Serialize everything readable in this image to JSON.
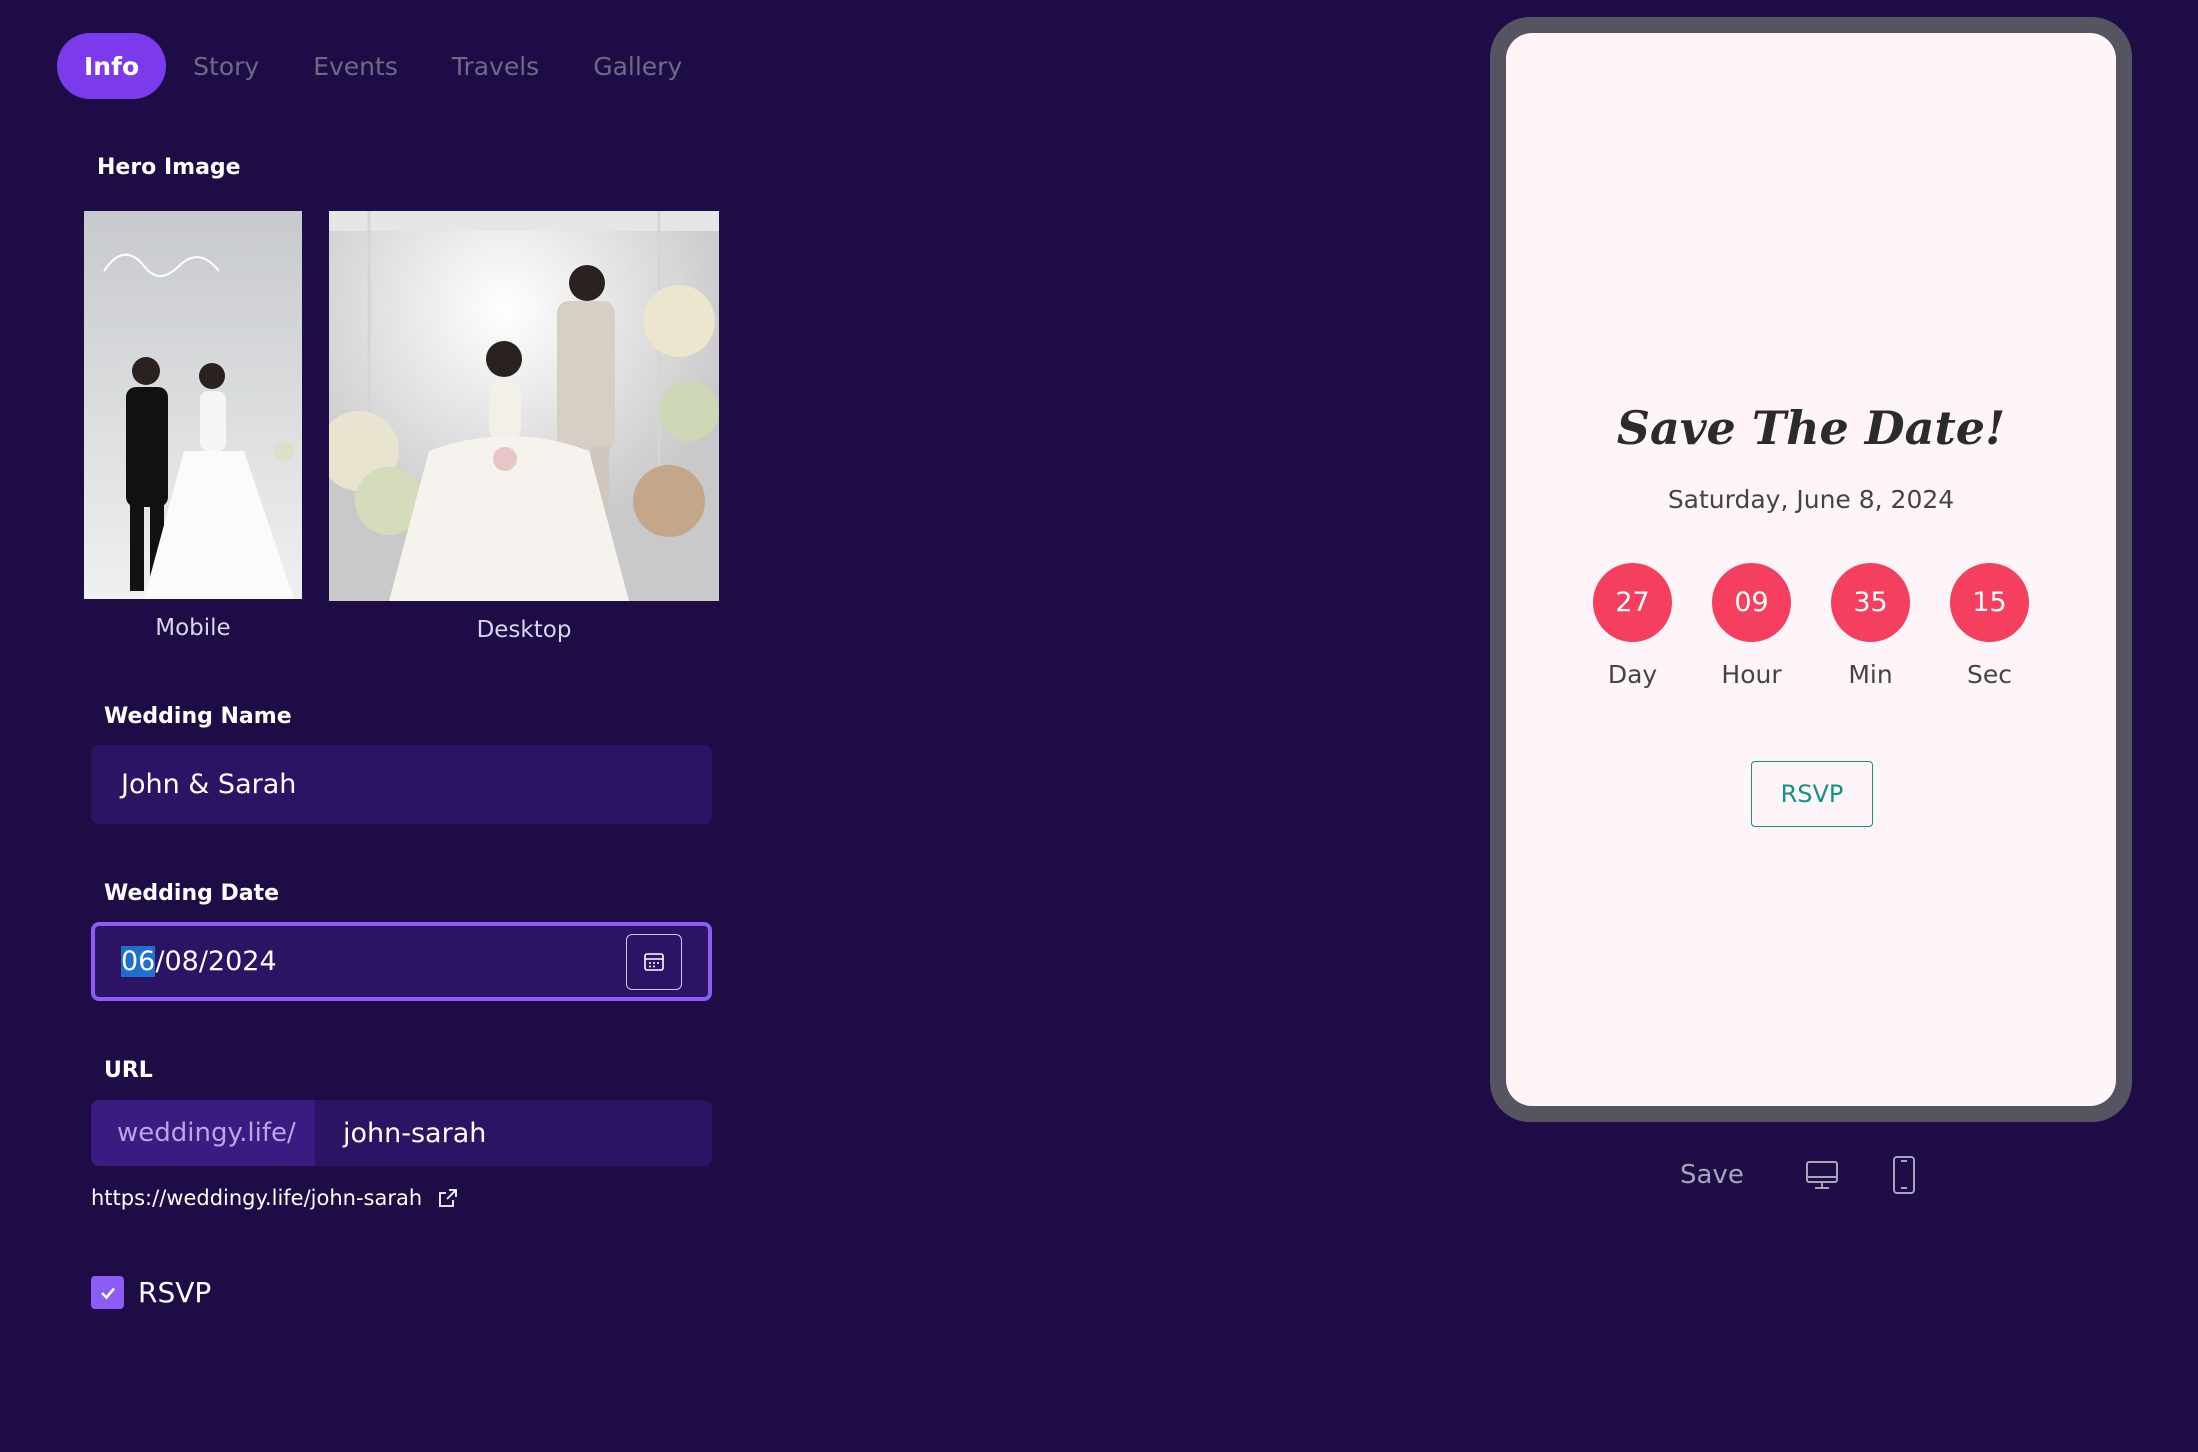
{
  "tabs": [
    {
      "label": "Info",
      "active": true
    },
    {
      "label": "Story",
      "active": false
    },
    {
      "label": "Events",
      "active": false
    },
    {
      "label": "Travels",
      "active": false
    },
    {
      "label": "Gallery",
      "active": false
    }
  ],
  "hero": {
    "label": "Hero Image",
    "mobile_caption": "Mobile",
    "desktop_caption": "Desktop"
  },
  "wedding_name": {
    "label": "Wedding Name",
    "value": "John & Sarah"
  },
  "wedding_date": {
    "label": "Wedding Date",
    "day": "06",
    "rest": "/08/2024"
  },
  "url": {
    "label": "URL",
    "prefix": "weddingy.life/",
    "slug": "john-sarah",
    "full": "https://weddingy.life/john-sarah"
  },
  "rsvp_checkbox": {
    "label": "RSVP",
    "checked": true
  },
  "preview": {
    "title": "Save The Date!",
    "date": "Saturday, June 8, 2024",
    "countdown": [
      {
        "value": "27",
        "label": "Day"
      },
      {
        "value": "09",
        "label": "Hour"
      },
      {
        "value": "35",
        "label": "Min"
      },
      {
        "value": "15",
        "label": "Sec"
      }
    ],
    "rsvp_button": "RSVP"
  },
  "actions": {
    "save_label": "Save"
  },
  "colors": {
    "background": "#1e0c47",
    "accent": "#7c3aed",
    "countdown": "#f43f5e",
    "rsvp": "#0f9488"
  }
}
